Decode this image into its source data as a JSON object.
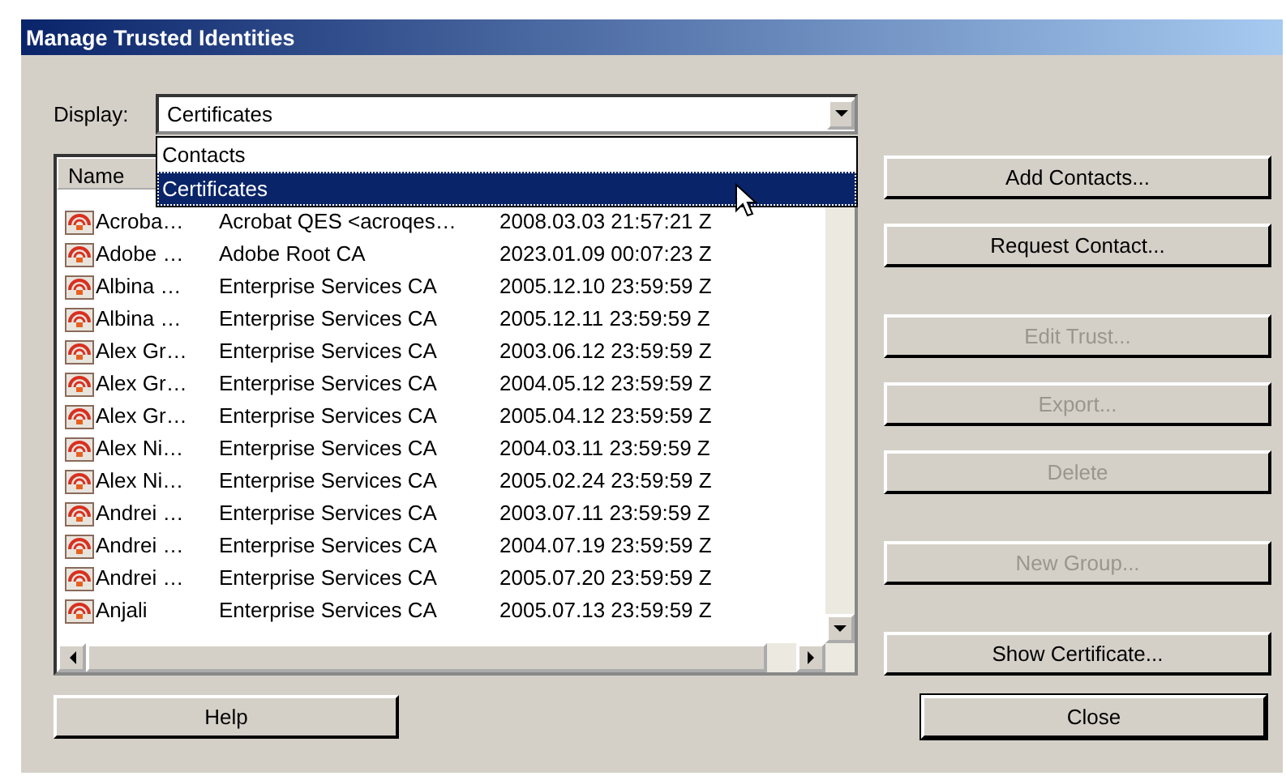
{
  "window": {
    "title": "Manage Trusted Identities"
  },
  "display": {
    "label": "Display:",
    "value": "Certificates",
    "expanded": true,
    "options": [
      {
        "label": "Contacts",
        "selected": false
      },
      {
        "label": "Certificates",
        "selected": true
      }
    ]
  },
  "table": {
    "columns": [
      "Name"
    ],
    "rows": [
      {
        "cells": [
          "Acroba…",
          "Acrobat QES <acroqes…",
          "2008.03.03 21:57:21 Z"
        ]
      },
      {
        "cells": [
          "Adobe …",
          "Adobe Root CA",
          "2023.01.09 00:07:23 Z"
        ]
      },
      {
        "cells": [
          "Albina …",
          "Enterprise Services CA",
          "2005.12.10 23:59:59 Z"
        ]
      },
      {
        "cells": [
          "Albina …",
          "Enterprise Services CA",
          "2005.12.11 23:59:59 Z"
        ]
      },
      {
        "cells": [
          "Alex Gr…",
          "Enterprise Services CA",
          "2003.06.12 23:59:59 Z"
        ]
      },
      {
        "cells": [
          "Alex Gr…",
          "Enterprise Services CA",
          "2004.05.12 23:59:59 Z"
        ]
      },
      {
        "cells": [
          "Alex Gr…",
          "Enterprise Services CA",
          "2005.04.12 23:59:59 Z"
        ]
      },
      {
        "cells": [
          "Alex Ni…",
          "Enterprise Services CA",
          "2004.03.11 23:59:59 Z"
        ]
      },
      {
        "cells": [
          "Alex Ni…",
          "Enterprise Services CA",
          "2005.02.24 23:59:59 Z"
        ]
      },
      {
        "cells": [
          "Andrei …",
          "Enterprise Services CA",
          "2003.07.11 23:59:59 Z"
        ]
      },
      {
        "cells": [
          "Andrei …",
          "Enterprise Services CA",
          "2004.07.19 23:59:59 Z"
        ]
      },
      {
        "cells": [
          "Andrei …",
          "Enterprise Services CA",
          "2005.07.20 23:59:59 Z"
        ]
      },
      {
        "cells": [
          "Anjali",
          "Enterprise Services CA",
          "2005.07.13 23:59:59 Z"
        ]
      }
    ]
  },
  "button_groups": [
    [
      {
        "label": "Add Contacts...",
        "disabled": false
      },
      {
        "label": "Request Contact...",
        "disabled": false
      }
    ],
    [
      {
        "label": "Edit Trust...",
        "disabled": true
      },
      {
        "label": "Export...",
        "disabled": true
      },
      {
        "label": "Delete",
        "disabled": true
      }
    ],
    [
      {
        "label": "New Group...",
        "disabled": true
      }
    ],
    [
      {
        "label": "Show Certificate...",
        "disabled": false
      }
    ]
  ],
  "footer_buttons": [
    {
      "label": "Help",
      "default": false
    },
    {
      "label": "Close",
      "default": true
    }
  ]
}
